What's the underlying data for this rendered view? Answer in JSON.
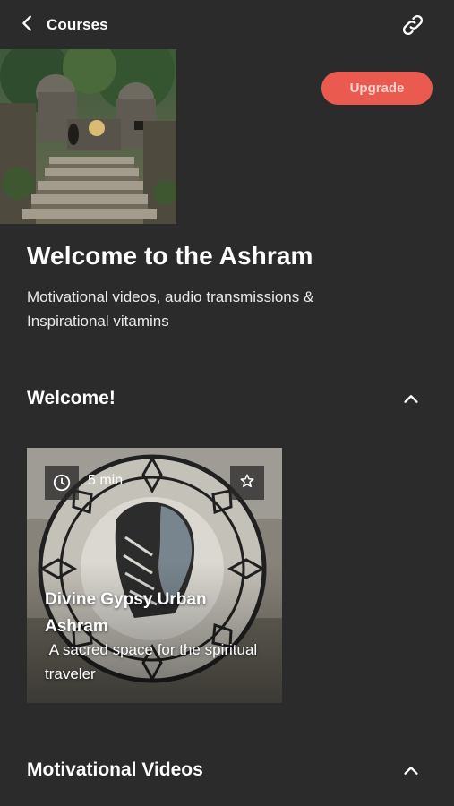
{
  "header": {
    "back_label": "Courses"
  },
  "upgrade": {
    "label": "Upgrade"
  },
  "course": {
    "title": "Welcome to the Ashram",
    "subtitle": "Motivational videos, audio transmissions & Inspirational vitamins"
  },
  "sections": [
    {
      "title": "Welcome!",
      "cards": [
        {
          "duration": "5 min",
          "title": "Divine Gypsy Urban Ashram",
          "description": " A sacred space for the spiritual traveler"
        }
      ]
    },
    {
      "title": "Motivational Videos"
    }
  ],
  "colors": {
    "background": "#2b2b2b",
    "accent": "#ea5a4f",
    "text": "#ffffff"
  },
  "icons": [
    "back-chevron-icon",
    "link-icon",
    "clock-icon",
    "star-icon",
    "chevron-up-icon"
  ]
}
